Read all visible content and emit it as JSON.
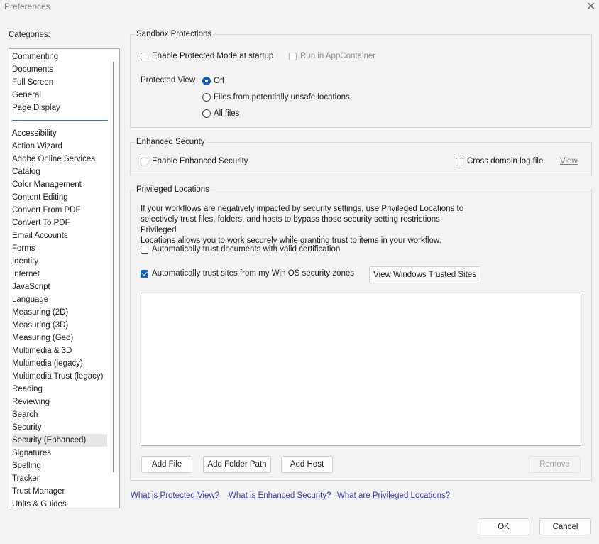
{
  "window": {
    "title": "Preferences"
  },
  "categories": {
    "label": "Categories:",
    "top_items": [
      "Commenting",
      "Documents",
      "Full Screen",
      "General",
      "Page Display"
    ],
    "items": [
      "Accessibility",
      "Action Wizard",
      "Adobe Online Services",
      "Catalog",
      "Color Management",
      "Content Editing",
      "Convert From PDF",
      "Convert To PDF",
      "Email Accounts",
      "Forms",
      "Identity",
      "Internet",
      "JavaScript",
      "Language",
      "Measuring (2D)",
      "Measuring (3D)",
      "Measuring (Geo)",
      "Multimedia & 3D",
      "Multimedia (legacy)",
      "Multimedia Trust (legacy)",
      "Reading",
      "Reviewing",
      "Search",
      "Security",
      "Security (Enhanced)",
      "Signatures",
      "Spelling",
      "Tracker",
      "Trust Manager",
      "Units & Guides"
    ],
    "selected": "Security (Enhanced)"
  },
  "sandbox": {
    "title": "Sandbox Protections",
    "protected_mode_label": "Enable Protected Mode at startup",
    "protected_mode_checked": false,
    "appcontainer_label": "Run in AppContainer",
    "appcontainer_checked": false,
    "protected_view_label": "Protected View",
    "options": [
      "Off",
      "Files from potentially unsafe locations",
      "All files"
    ],
    "selected_option": "Off"
  },
  "enhanced": {
    "title": "Enhanced Security",
    "enable_label": "Enable Enhanced Security",
    "enable_checked": false,
    "cross_domain_label": "Cross domain log file",
    "cross_domain_checked": false,
    "view_link": "View"
  },
  "privileged": {
    "title": "Privileged Locations",
    "description_line1": "If your workflows are negatively impacted by security settings, use Privileged Locations to",
    "description_line2": "selectively trust files, folders, and hosts to bypass those security setting restrictions. Privileged",
    "description_line3": "Locations allows you to work securely while granting trust to items in your workflow.",
    "trust_cert_label": "Automatically trust documents with valid certification",
    "trust_cert_checked": false,
    "trust_sites_label": "Automatically trust sites from my Win OS security zones",
    "trust_sites_checked": true,
    "view_trusted_sites_button": "View Windows Trusted Sites",
    "add_file_button": "Add File",
    "add_folder_button": "Add Folder Path",
    "add_host_button": "Add Host",
    "remove_button": "Remove"
  },
  "links": {
    "protected_view": "What is Protected View?",
    "enhanced_security": "What is Enhanced Security?",
    "privileged_locations": "What are Privileged Locations?"
  },
  "footer": {
    "ok": "OK",
    "cancel": "Cancel"
  },
  "colors": {
    "accent": "#1b5fa8",
    "link": "#3a3aa0",
    "separator": "#2a7ab8"
  }
}
